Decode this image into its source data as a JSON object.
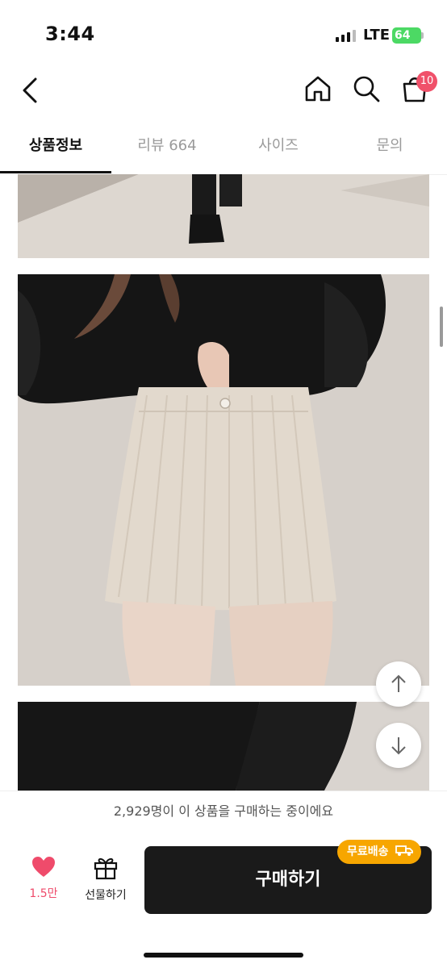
{
  "status_bar": {
    "time": "3:44",
    "network": "LTE",
    "battery": "64"
  },
  "header": {
    "cart_count": "10"
  },
  "tabs": [
    {
      "label": "상품정보",
      "active": true
    },
    {
      "label": "리뷰 664",
      "active": false
    },
    {
      "label": "사이즈",
      "active": false
    },
    {
      "label": "문의",
      "active": false
    }
  ],
  "purchase_notice": "2,929명이 이 상품을 구매하는 중이에요",
  "bottom_bar": {
    "like_count": "1.5만",
    "gift_label": "선물하기",
    "buy_label": "구매하기",
    "free_shipping_badge": "무료배송"
  },
  "colors": {
    "accent_pink": "#ef4b6b",
    "badge_orange": "#f7a600",
    "button_dark": "#1a1a1a"
  }
}
